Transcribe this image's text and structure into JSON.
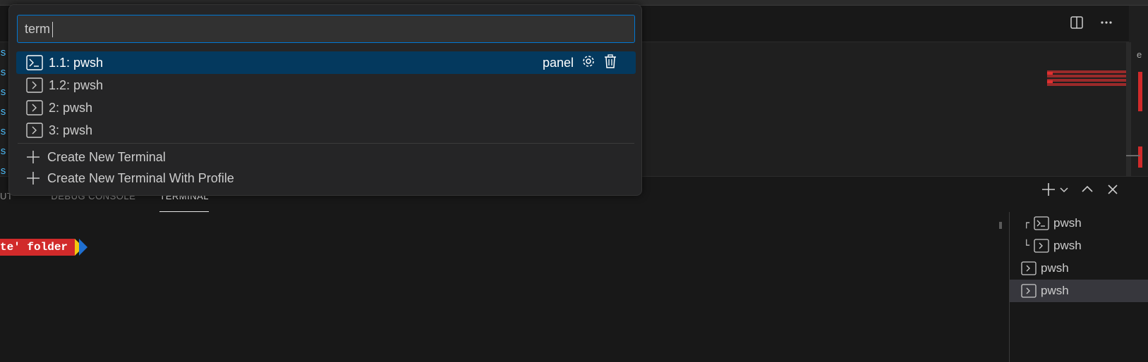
{
  "quick_pick": {
    "input_value": "term",
    "terminals": [
      {
        "label": "1.1: pwsh",
        "icon": "terminal-powershell-icon",
        "active": true,
        "detail": "panel"
      },
      {
        "label": "1.2: pwsh",
        "icon": "terminal-icon",
        "active": false
      },
      {
        "label": "2: pwsh",
        "icon": "terminal-icon",
        "active": false
      },
      {
        "label": "3: pwsh",
        "icon": "terminal-icon",
        "active": false
      }
    ],
    "actions": [
      {
        "label": "Create New Terminal",
        "icon": "plus-icon"
      },
      {
        "label": "Create New Terminal With Profile",
        "icon": "plus-icon"
      }
    ]
  },
  "editor": {
    "edge_text": "s",
    "right_edge_letter": "e"
  },
  "panel": {
    "tabs": [
      {
        "label": "UT",
        "active": false
      },
      {
        "label": "DEBUG CONSOLE",
        "active": false
      },
      {
        "label": "TERMINAL",
        "active": true
      }
    ],
    "prompt_text": "te' folder",
    "terminal_list": [
      {
        "label": "pwsh",
        "tree": "┌",
        "icon": "terminal-powershell-icon",
        "selected": false
      },
      {
        "label": "pwsh",
        "tree": "└",
        "icon": "terminal-icon",
        "selected": false
      },
      {
        "label": "pwsh",
        "tree": "",
        "icon": "terminal-icon",
        "selected": false
      },
      {
        "label": "pwsh",
        "tree": "",
        "icon": "terminal-icon",
        "selected": true
      }
    ]
  },
  "colors": {
    "accent": "#0078d4",
    "selection": "#04395e",
    "prompt_red": "#d12a2a",
    "prompt_yellow": "#f2c80f",
    "prompt_blue": "#1f6fd1"
  }
}
